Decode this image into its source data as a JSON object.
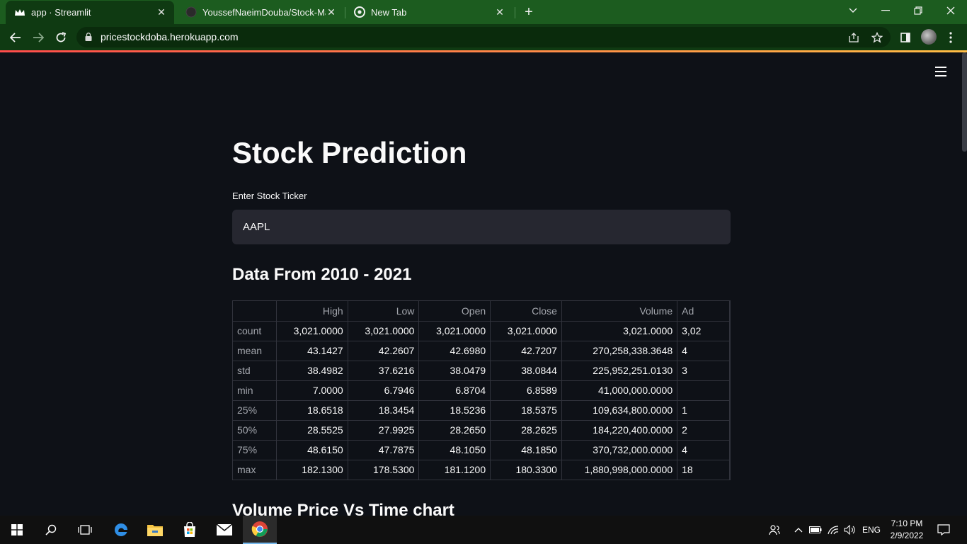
{
  "browser": {
    "tabs": [
      {
        "title": "app · Streamlit",
        "active": true
      },
      {
        "title": "YoussefNaeimDouba/Stock-Mark",
        "active": false
      },
      {
        "title": "New Tab",
        "active": false
      }
    ],
    "url": "pricestockdoba.herokuapp.com"
  },
  "page": {
    "title": "Stock Prediction",
    "ticker_label": "Enter Stock Ticker",
    "ticker_value": "AAPL",
    "section1": "Data From 2010 - 2021",
    "section2": "Volume Price Vs Time chart"
  },
  "table": {
    "columns": [
      "High",
      "Low",
      "Open",
      "Close",
      "Volume",
      "Ad"
    ],
    "rows": [
      {
        "label": "count",
        "cells": [
          "3,021.0000",
          "3,021.0000",
          "3,021.0000",
          "3,021.0000",
          "3,021.0000",
          "3,02"
        ]
      },
      {
        "label": "mean",
        "cells": [
          "43.1427",
          "42.2607",
          "42.6980",
          "42.7207",
          "270,258,338.3648",
          "4"
        ]
      },
      {
        "label": "std",
        "cells": [
          "38.4982",
          "37.6216",
          "38.0479",
          "38.0844",
          "225,952,251.0130",
          "3"
        ]
      },
      {
        "label": "min",
        "cells": [
          "7.0000",
          "6.7946",
          "6.8704",
          "6.8589",
          "41,000,000.0000",
          ""
        ]
      },
      {
        "label": "25%",
        "cells": [
          "18.6518",
          "18.3454",
          "18.5236",
          "18.5375",
          "109,634,800.0000",
          "1"
        ]
      },
      {
        "label": "50%",
        "cells": [
          "28.5525",
          "27.9925",
          "28.2650",
          "28.2625",
          "184,220,400.0000",
          "2"
        ]
      },
      {
        "label": "75%",
        "cells": [
          "48.6150",
          "47.7875",
          "48.1050",
          "48.1850",
          "370,732,000.0000",
          "4"
        ]
      },
      {
        "label": "max",
        "cells": [
          "182.1300",
          "178.5300",
          "181.1200",
          "180.3300",
          "1,880,998,000.0000",
          "18"
        ]
      }
    ]
  },
  "taskbar": {
    "language": "ENG",
    "time": "7:10 PM",
    "date": "2/9/2022"
  },
  "colors": {
    "accent_start": "#ff4b4b",
    "accent_end": "#ffbd45",
    "background": "#0e1117",
    "chrome_green": "#1c5c1f"
  }
}
